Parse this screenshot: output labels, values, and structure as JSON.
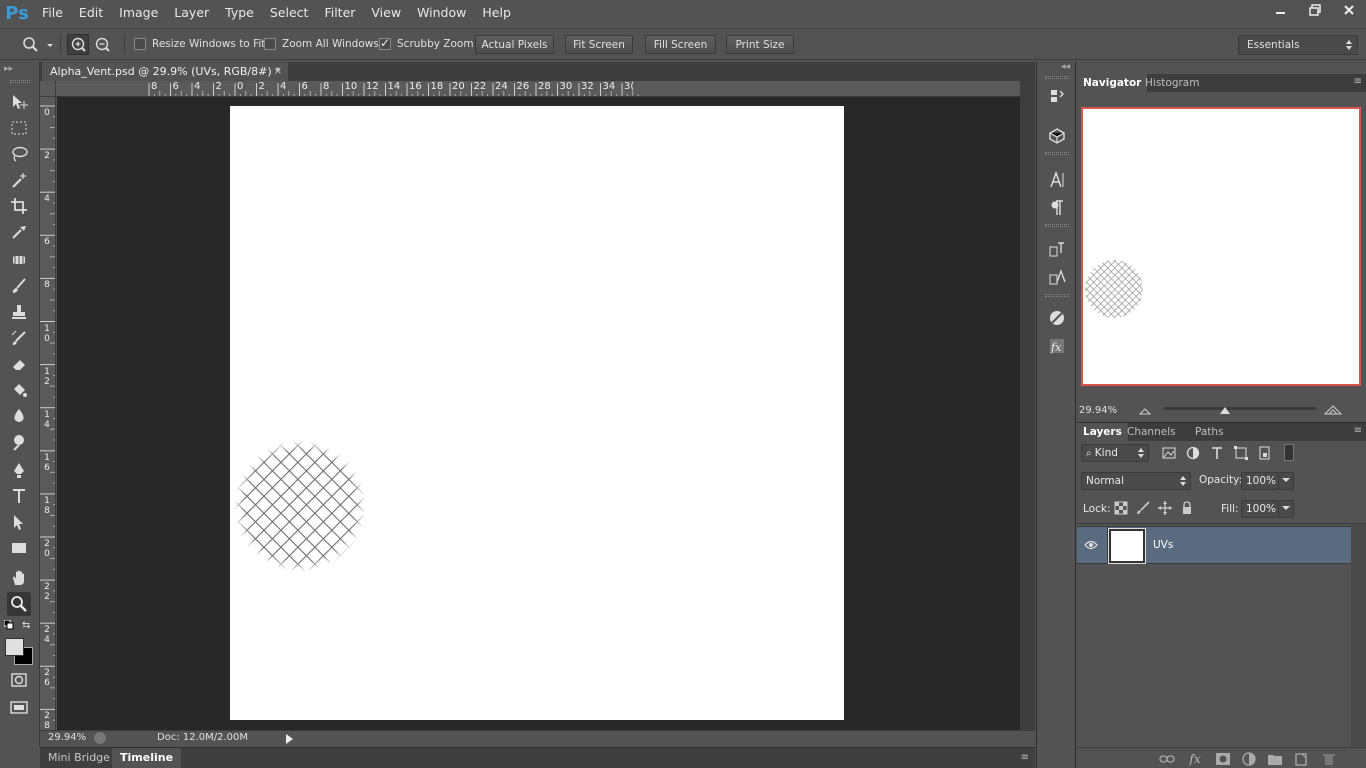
{
  "app": {
    "logo": "Ps"
  },
  "menu": [
    "File",
    "Edit",
    "Image",
    "Layer",
    "Type",
    "Select",
    "Filter",
    "View",
    "Window",
    "Help"
  ],
  "options": {
    "resize_windows_label": "Resize Windows to Fit",
    "resize_windows_checked": false,
    "zoom_all_label": "Zoom All Windows",
    "zoom_all_checked": false,
    "scrubby_label": "Scrubby Zoom",
    "scrubby_checked": true,
    "actual_pixels": "Actual Pixels",
    "fit_screen": "Fit Screen",
    "fill_screen": "Fill Screen",
    "print_size": "Print Size",
    "workspace": "Essentials"
  },
  "document": {
    "tab_title": "Alpha_Vent.psd @ 29.9% (UVs, RGB/8#) *",
    "close": "×"
  },
  "rulers": {
    "h_labels": [
      "8",
      "6",
      "4",
      "2",
      "0",
      "2",
      "4",
      "6",
      "8",
      "10",
      "12",
      "14",
      "16",
      "18",
      "20",
      "22",
      "24",
      "26",
      "28",
      "30",
      "32",
      "34",
      "3("
    ],
    "v_labels": [
      "0",
      "2",
      "4",
      "6",
      "8",
      "10",
      "12",
      "14",
      "16",
      "18",
      "20",
      "22",
      "24",
      "26",
      "28"
    ]
  },
  "status": {
    "zoom": "29.94%",
    "doc": "Doc: 12.0M/2.00M"
  },
  "bottom_tabs": [
    "Mini Bridge",
    "Timeline"
  ],
  "navigator": {
    "tabs": [
      "Navigator",
      "Histogram"
    ],
    "zoom": "29.94%",
    "slider_fraction": 0.4
  },
  "layers": {
    "tabs": [
      "Layers",
      "Channels",
      "Paths"
    ],
    "filter_kind": "Kind",
    "blend_mode": "Normal",
    "opacity_label": "Opacity:",
    "opacity": "100%",
    "lock_label": "Lock:",
    "fill_label": "Fill:",
    "fill": "100%",
    "items": [
      {
        "name": "UVs",
        "visible": true
      }
    ]
  },
  "colors": {
    "accent": "#3d9ad9",
    "selection": "#5a6b80",
    "nav_frame": "#d9534f"
  }
}
